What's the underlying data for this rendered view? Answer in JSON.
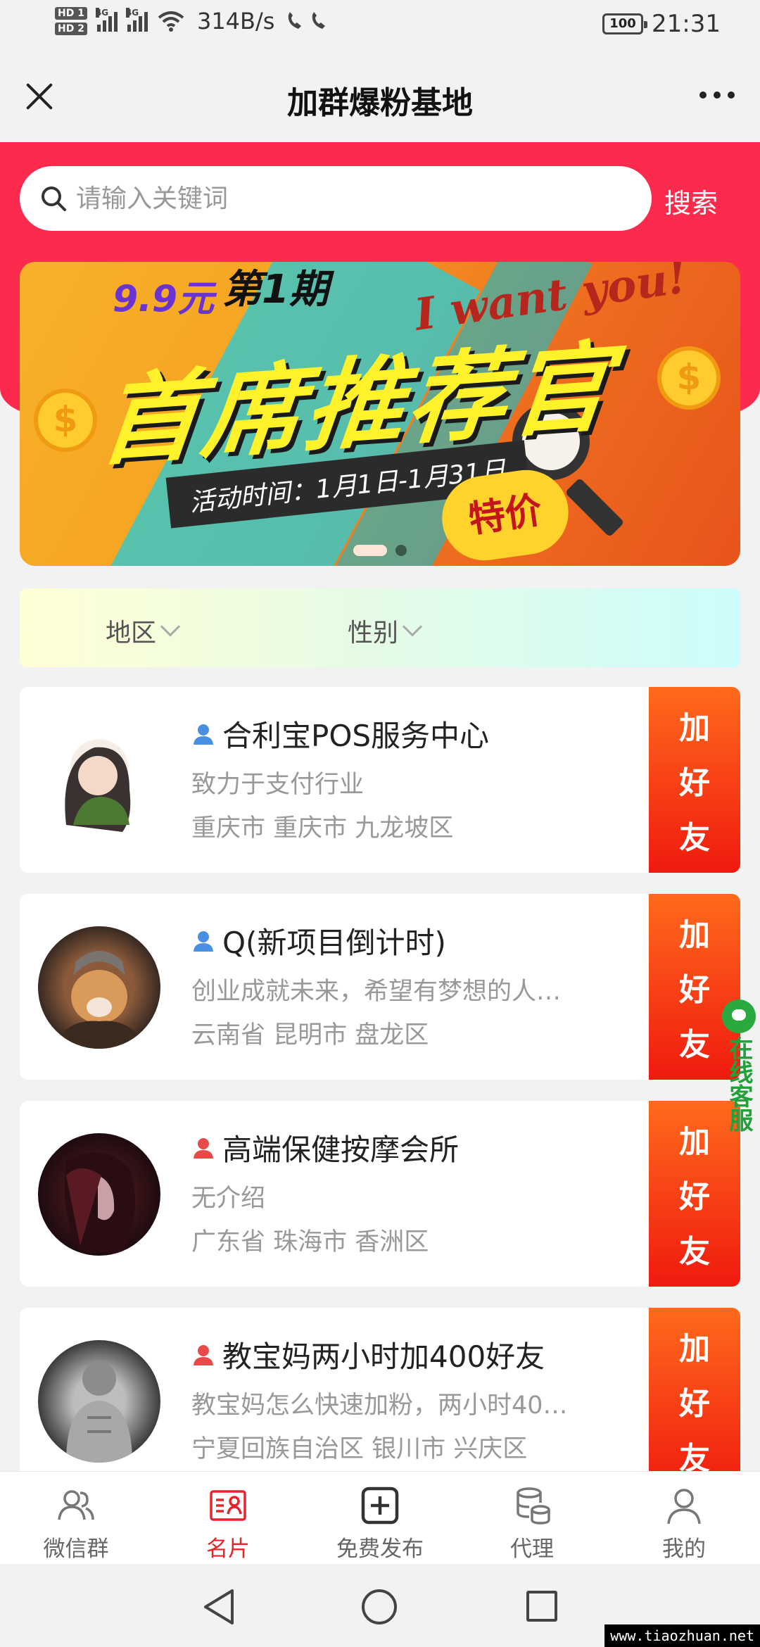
{
  "status_bar": {
    "hd1": "HD 1",
    "hd2": "HD 2",
    "net1": "4G",
    "net2": "4G",
    "speed": "314B/s",
    "battery": "100",
    "time": "21:31"
  },
  "title_bar": {
    "title": "加群爆粉基地"
  },
  "search": {
    "placeholder": "请输入关键词",
    "button_label": "搜索"
  },
  "banner": {
    "price": "9.9元",
    "period": "第1期",
    "slogan": "I want you!",
    "headline": "首席推荐官",
    "dates": "活动时间：1月1日-1月31日",
    "special": "特价",
    "active_slide": 1,
    "slide_count": 2
  },
  "filters": {
    "region": "地区",
    "gender": "性别"
  },
  "cards": [
    {
      "name": "合利宝POS服务中心",
      "desc": "致力于支付行业",
      "location": "重庆市 重庆市 九龙坡区",
      "gender_color": "#4a90e2",
      "add_label": [
        "加",
        "好",
        "友"
      ]
    },
    {
      "name": "Q(新项目倒计时)",
      "desc": "创业成就未来，希望有梦想的人…",
      "location": "云南省 昆明市 盘龙区",
      "gender_color": "#4a90e2",
      "add_label": [
        "加",
        "好",
        "友"
      ]
    },
    {
      "name": "高端保健按摩会所",
      "desc": "无介绍",
      "location": "广东省 珠海市 香洲区",
      "gender_color": "#e84a4a",
      "add_label": [
        "加",
        "好",
        "友"
      ]
    },
    {
      "name": "教宝妈两小时加400好友",
      "desc": "教宝妈怎么快速加粉，两小时40…",
      "location": "宁夏回族自治区 银川市 兴庆区",
      "gender_color": "#e84a4a",
      "add_label": [
        "加",
        "好",
        "友"
      ]
    }
  ],
  "customer_service": {
    "label": "在线客服"
  },
  "bottom_nav": {
    "items": [
      {
        "label": "微信群",
        "icon": "group-icon",
        "active": false
      },
      {
        "label": "名片",
        "icon": "card-icon",
        "active": true
      },
      {
        "label": "免费发布",
        "icon": "add-square-icon",
        "active": false
      },
      {
        "label": "代理",
        "icon": "database-icon",
        "active": false
      },
      {
        "label": "我的",
        "icon": "person-icon",
        "active": false
      }
    ]
  },
  "colors": {
    "brand_red": "#fc2b4e",
    "button_orange": "#ff6a1c",
    "active_nav": "#e8242b"
  },
  "watermark": "www.tiaozhuan.net"
}
